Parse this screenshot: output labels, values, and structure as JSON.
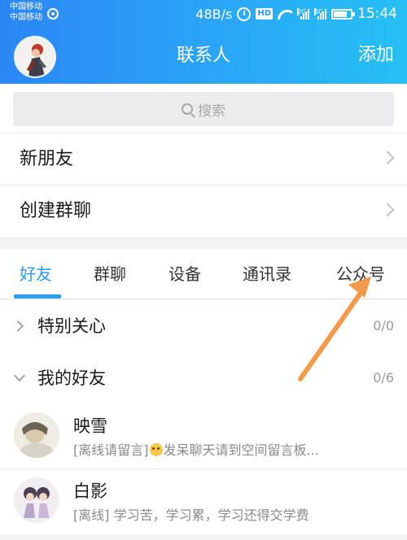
{
  "status_bar": {
    "carrier_1": "中国移动",
    "carrier_2": "中国移动",
    "net_speed": "48B/s",
    "hd": "HD",
    "sig1_tag": "2G",
    "sig2_tag": "4G",
    "time": "15:44"
  },
  "header": {
    "title": "联系人",
    "add_label": "添加"
  },
  "search": {
    "placeholder": "搜索"
  },
  "menu": {
    "new_friends": "新朋友",
    "create_group": "创建群聊"
  },
  "tabs": [
    {
      "label": "好友",
      "active": true
    },
    {
      "label": "群聊"
    },
    {
      "label": "设备"
    },
    {
      "label": "通讯录"
    },
    {
      "label": "公众号"
    }
  ],
  "groups": [
    {
      "label": "特别关心",
      "count": "0/0",
      "expanded": false
    },
    {
      "label": "我的好友",
      "count": "0/6",
      "expanded": true
    }
  ],
  "friends": [
    {
      "name": "映雪",
      "status_prefix": "[离线请留言]",
      "status_text": "发呆聊天请到空间留言板..."
    },
    {
      "name": "白影",
      "status_prefix": "[离线]",
      "status_text": " 学习苦，学习累，学习还得交学费"
    }
  ],
  "colors": {
    "accent": "#2a9cf6",
    "header_start": "#2b86f5",
    "header_end": "#26c0f4",
    "annotation_arrow": "#f2994a"
  },
  "icons": [
    "alarm-icon",
    "wifi-icon",
    "signal-icon",
    "battery-icon",
    "search-icon",
    "chevron-right-icon",
    "chevron-down-icon",
    "annotation-arrow"
  ]
}
